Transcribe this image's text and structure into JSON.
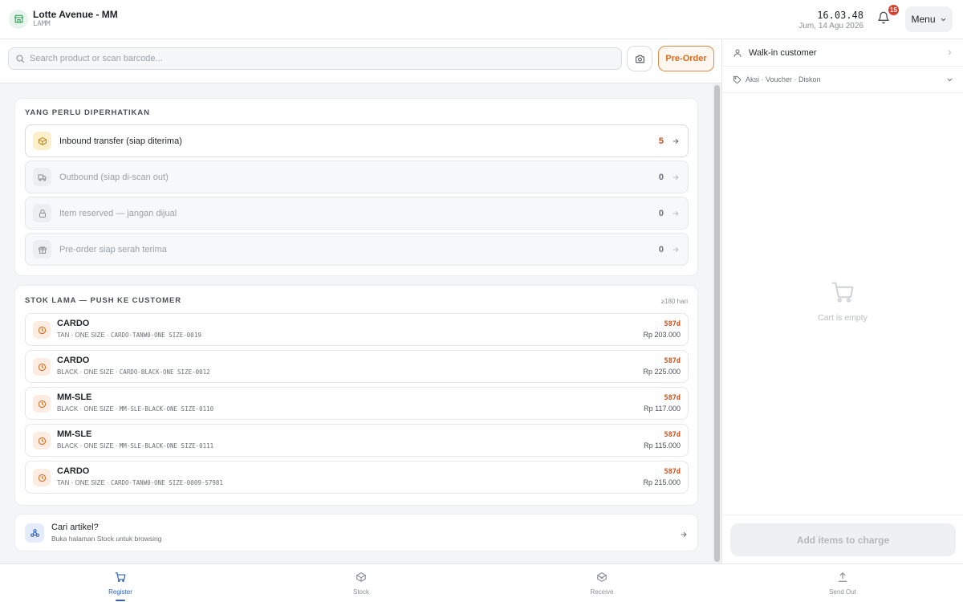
{
  "header": {
    "store_name": "Lotte Avenue - MM",
    "store_code": "LAMM",
    "time": "16.03.48",
    "date": "Jum, 14 Agu 2026",
    "notification_count": "15",
    "menu_label": "Menu"
  },
  "search": {
    "placeholder": "Search product or scan barcode...",
    "preorder_label": "Pre-Order"
  },
  "attention": {
    "title": "YANG PERLU DIPERHATIKAN",
    "items": [
      {
        "label": "Inbound transfer (siap diterima)",
        "count": "5",
        "icon": "package-icon",
        "active": true
      },
      {
        "label": "Outbound (siap di-scan out)",
        "count": "0",
        "icon": "truck-icon",
        "active": false
      },
      {
        "label": "Item reserved — jangan dijual",
        "count": "0",
        "icon": "lock-icon",
        "active": false
      },
      {
        "label": "Pre-order siap serah terima",
        "count": "0",
        "icon": "gift-icon",
        "active": false
      }
    ]
  },
  "old_stock": {
    "title": "STOK LAMA — PUSH KE CUSTOMER",
    "threshold": "≥180 hari",
    "items": [
      {
        "name": "CARDO",
        "variant": "TAN · ONE SIZE · ",
        "sku": "CARDO-TANW0-ONE SIZE-0019",
        "age": "587d",
        "price": "Rp 203.000"
      },
      {
        "name": "CARDO",
        "variant": "BLACK · ONE SIZE · ",
        "sku": "CARDO-BLACK-ONE SIZE-0012",
        "age": "587d",
        "price": "Rp 225.000"
      },
      {
        "name": "MM-SLE",
        "variant": "BLACK · ONE SIZE · ",
        "sku": "MM-SLE-BLACK-ONE SIZE-0110",
        "age": "587d",
        "price": "Rp 117.000"
      },
      {
        "name": "MM-SLE",
        "variant": "BLACK · ONE SIZE · ",
        "sku": "MM-SLE-BLACK-ONE SIZE-0111",
        "age": "587d",
        "price": "Rp 115.000"
      },
      {
        "name": "CARDO",
        "variant": "TAN · ONE SIZE · ",
        "sku": "CARDO-TANW0-ONE SIZE-0009-S7981",
        "age": "587d",
        "price": "Rp 215.000"
      }
    ]
  },
  "cari": {
    "title": "Cari artikel?",
    "subtitle": "Buka halaman Stock untuk browsing"
  },
  "cart": {
    "customer": "Walk-in customer",
    "actions": "Aksi · Voucher · Diskon",
    "empty_text": "Cart is empty",
    "charge_label": "Add items to charge"
  },
  "nav": {
    "items": [
      {
        "label": "Register",
        "icon": "cart-icon",
        "active": true
      },
      {
        "label": "Stock",
        "icon": "box-icon",
        "active": false
      },
      {
        "label": "Receive",
        "icon": "receive-icon",
        "active": false
      },
      {
        "label": "Send Out",
        "icon": "upload-icon",
        "active": false
      }
    ]
  },
  "colors": {
    "accent_orange": "#d66a1d",
    "accent_blue": "#2f5fb8",
    "badge_red": "#d93d2e",
    "store_green": "#2e9e55"
  }
}
